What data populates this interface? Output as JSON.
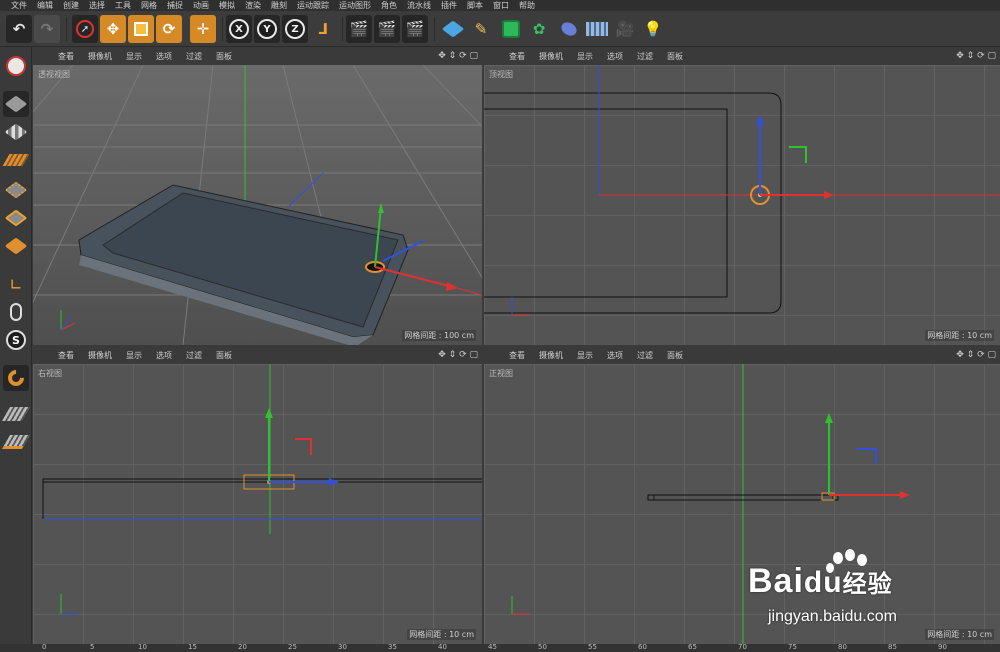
{
  "menubar": [
    "文件",
    "编辑",
    "创建",
    "选择",
    "工具",
    "网格",
    "捕捉",
    "动画",
    "模拟",
    "渲染",
    "雕刻",
    "运动跟踪",
    "运动图形",
    "角色",
    "流水线",
    "插件",
    "脚本",
    "窗口",
    "帮助"
  ],
  "toolbar": {
    "undo_icon": "undo-icon",
    "redo_icon": "redo-icon",
    "axis_labels": [
      "X",
      "Y",
      "Z"
    ]
  },
  "viewport_menu": [
    "查看",
    "摄像机",
    "显示",
    "选项",
    "过滤",
    "面板"
  ],
  "viewports": {
    "perspective": {
      "name": "透视视图",
      "grid_label": "网格间距 : 100 cm"
    },
    "top": {
      "name": "顶视图",
      "grid_label": "网格间距 : 10 cm"
    },
    "right": {
      "name": "右视图",
      "grid_label": "网格间距 : 10 cm"
    },
    "front": {
      "name": "正视图",
      "grid_label": "网格间距 : 10 cm"
    }
  },
  "axis_letters": {
    "x": "X",
    "y": "Y",
    "z": "Z"
  },
  "timeline": {
    "ticks": [
      "0",
      "5",
      "10",
      "15",
      "20",
      "25",
      "30",
      "35",
      "40",
      "45",
      "50",
      "55",
      "60",
      "65",
      "70",
      "75",
      "80",
      "85",
      "90"
    ]
  },
  "watermark": {
    "brand": "Bai",
    "brand_cn": "经验",
    "url": "jingyan.baidu.com"
  },
  "colors": {
    "x_axis": "#e03030",
    "y_axis": "#30c030",
    "z_axis": "#3050e0",
    "active_orange": "#d58a25",
    "viewport_bg": "#545454"
  }
}
